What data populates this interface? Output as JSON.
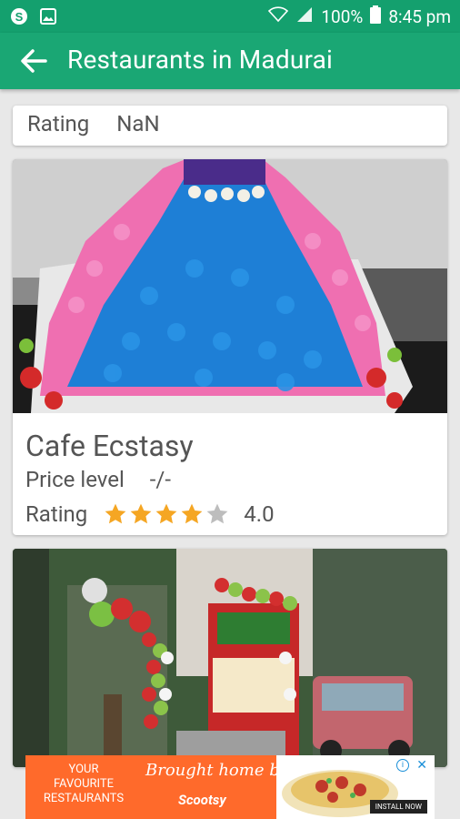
{
  "status_bar": {
    "battery": "100%",
    "time": "8:45 pm"
  },
  "app_bar": {
    "title": "Restaurants in Madurai"
  },
  "top_card": {
    "rating_label": "Rating",
    "rating_value": "NaN"
  },
  "restaurants": [
    {
      "name": "Cafe Ecstasy",
      "price_label": "Price level",
      "price_value": "-/-",
      "rating_label": "Rating",
      "rating_value": "4.0",
      "stars_filled": 4,
      "stars_total": 5
    }
  ],
  "ad": {
    "line1": "YOUR FAVOURITE RESTAURANTS",
    "line2": "Brought home by",
    "brand": "Scootsy",
    "cta": "INSTALL NOW"
  },
  "colors": {
    "primary": "#1aa774",
    "statusbar": "#14a06e",
    "star": "#f5a623",
    "star_empty": "#bdbdbd"
  }
}
